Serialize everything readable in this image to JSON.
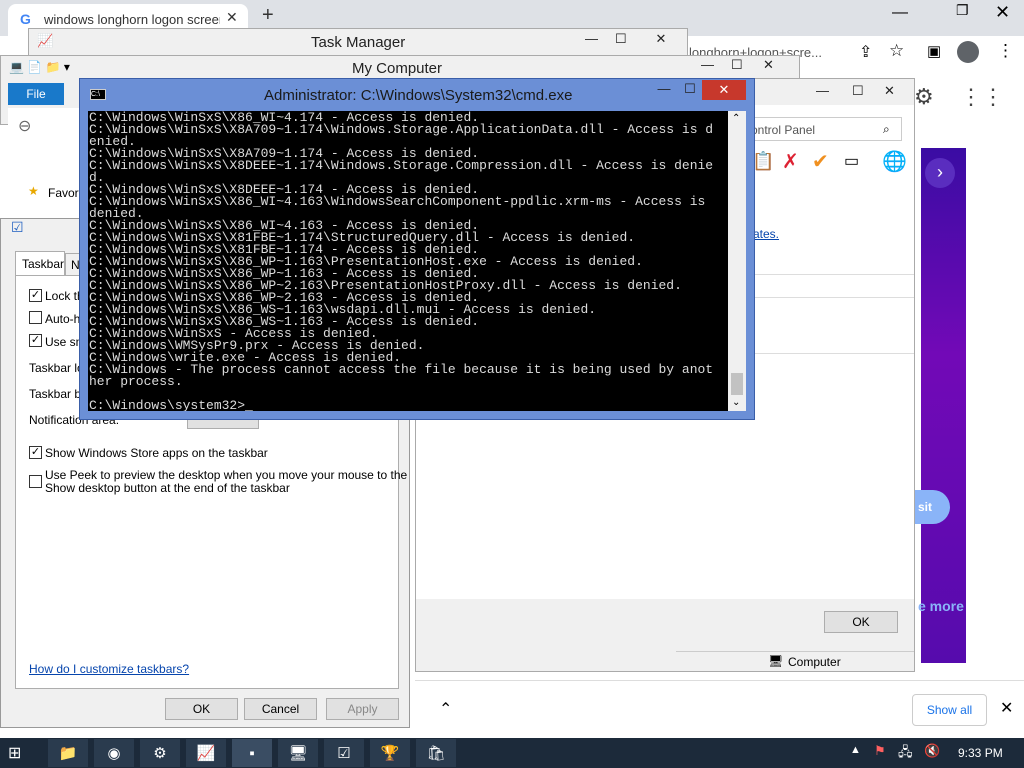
{
  "chrome": {
    "tab_title": "windows longhorn logon screen",
    "new_tab": "+",
    "address_partial": "longhorn+logon+scre..."
  },
  "task_manager": {
    "title": "Task Manager"
  },
  "my_computer": {
    "title": "My Computer",
    "file_tab": "File",
    "favorites": "Favor",
    "computer": "Computer"
  },
  "taskbar_props": {
    "tabs": [
      "Taskbar",
      "N"
    ],
    "options": [
      {
        "label": "Lock th",
        "checked": true
      },
      {
        "label": "Auto-h",
        "checked": false
      },
      {
        "label": "Use sm",
        "checked": true
      }
    ],
    "row_labels": [
      "Taskbar lo",
      "Taskbar bu",
      "Notification area:"
    ],
    "store_apps": "Show Windows Store apps on the taskbar",
    "peek_line1": "Use Peek to preview the desktop when you move your mouse to the",
    "peek_line2": "Show desktop button at the end of the taskbar",
    "help_link": "How do I customize taskbars?",
    "ok": "OK",
    "cancel": "Cancel",
    "apply": "Apply"
  },
  "control_panel": {
    "search_placeholder": "ontrol Panel",
    "link_fragment": "ates.",
    "ok": "OK"
  },
  "browser_right": {
    "visit": "sit",
    "see_more": "e more",
    "show_all": "Show all"
  },
  "cmd": {
    "title": "Administrator: C:\\Windows\\System32\\cmd.exe",
    "lines": [
      "C:\\Windows\\WinSxS\\X86_WI~4.174 - Access is denied.",
      "C:\\Windows\\WinSxS\\X8A709~1.174\\Windows.Storage.ApplicationData.dll - Access is d",
      "enied.",
      "C:\\Windows\\WinSxS\\X8A709~1.174 - Access is denied.",
      "C:\\Windows\\WinSxS\\X8DEEE~1.174\\Windows.Storage.Compression.dll - Access is denie",
      "d.",
      "C:\\Windows\\WinSxS\\X8DEEE~1.174 - Access is denied.",
      "C:\\Windows\\WinSxS\\X86_WI~4.163\\WindowsSearchComponent-ppdlic.xrm-ms - Access is",
      "denied.",
      "C:\\Windows\\WinSxS\\X86_WI~4.163 - Access is denied.",
      "C:\\Windows\\WinSxS\\X81FBE~1.174\\StructuredQuery.dll - Access is denied.",
      "C:\\Windows\\WinSxS\\X81FBE~1.174 - Access is denied.",
      "C:\\Windows\\WinSxS\\X86_WP~1.163\\PresentationHost.exe - Access is denied.",
      "C:\\Windows\\WinSxS\\X86_WP~1.163 - Access is denied.",
      "C:\\Windows\\WinSxS\\X86_WP~2.163\\PresentationHostProxy.dll - Access is denied.",
      "C:\\Windows\\WinSxS\\X86_WP~2.163 - Access is denied.",
      "C:\\Windows\\WinSxS\\X86_WS~1.163\\wsdapi.dll.mui - Access is denied.",
      "C:\\Windows\\WinSxS\\X86_WS~1.163 - Access is denied.",
      "C:\\Windows\\WinSxS - Access is denied.",
      "C:\\Windows\\WMSysPr9.prx - Access is denied.",
      "C:\\Windows\\write.exe - Access is denied.",
      "C:\\Windows - The process cannot access the file because it is being used by anot",
      "her process.",
      "",
      "C:\\Windows\\system32>_"
    ]
  },
  "taskbar": {
    "clock": "9:33 PM",
    "apps": [
      "file-explorer-icon",
      "chrome-icon",
      "settings-icon",
      "task-manager-icon",
      "cmd-icon",
      "control-panel-icon",
      "checklist-icon",
      "trophy-icon",
      "store-icon"
    ]
  }
}
